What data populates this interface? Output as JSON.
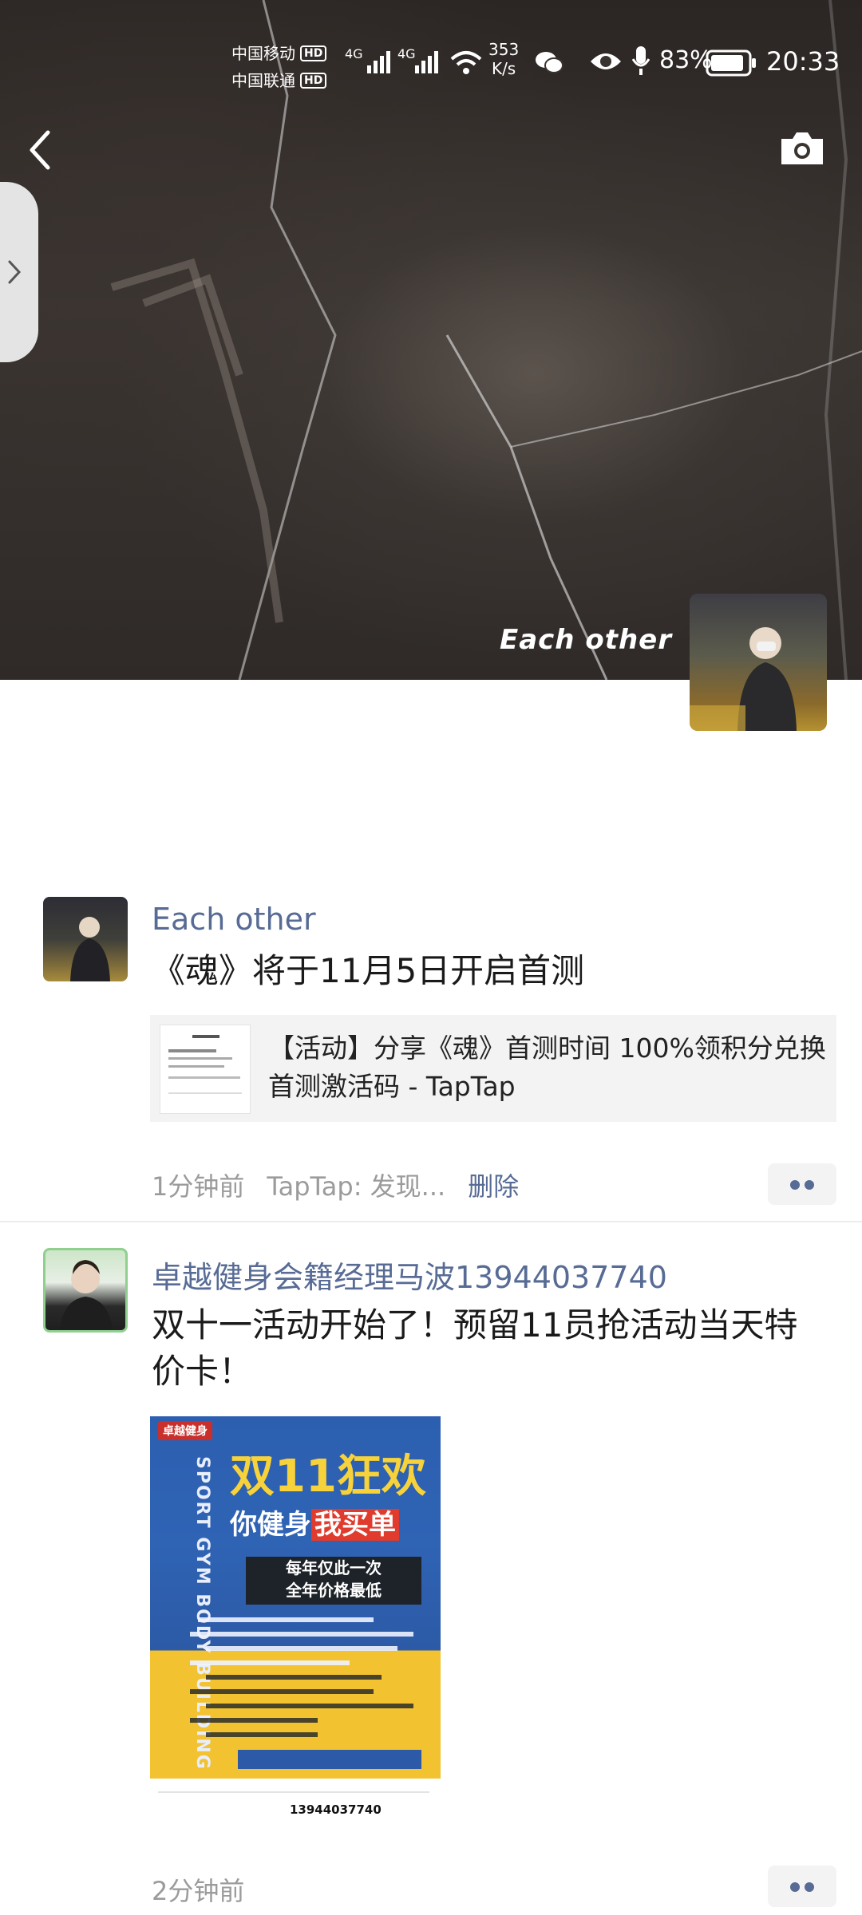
{
  "status_bar": {
    "carrier1": "中国移动",
    "carrier2": "中国联通",
    "hd": "HD",
    "net": "4G",
    "speed_value": "353",
    "speed_unit": "K/s",
    "battery": "83%",
    "time": "20:33"
  },
  "header": {
    "back_icon": "chevron-left-icon",
    "camera_icon": "camera-icon"
  },
  "cover": {
    "name": "Each other"
  },
  "posts": [
    {
      "nickname": "Each other",
      "text": "《魂》将于11月5日开启首测",
      "link_title": "【活动】分享《魂》首测时间 100%领积分兑换首测激活码 - TapTap",
      "time": "1分钟前",
      "source": "TapTap: 发现...",
      "delete_label": "删除"
    },
    {
      "nickname": "卓越健身会籍经理马波13944037740",
      "text": "双十一活动开始了！预留11员抢活动当天特价卡！",
      "time": "2分钟前",
      "poster": {
        "brand": "卓越健身",
        "vertical": "SPORT GYM BODY BUILDING",
        "headline": "双11狂欢",
        "sub_prefix": "你健身",
        "sub_highlight": "我买单",
        "banner_line1": "每年仅此一次",
        "banner_line2": "全年价格最低",
        "phone": "13944037740"
      }
    }
  ]
}
